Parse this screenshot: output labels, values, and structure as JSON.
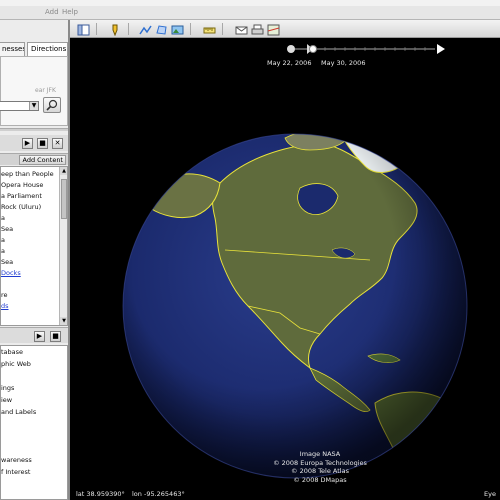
{
  "menu": {
    "items": [
      "Add",
      "Help"
    ]
  },
  "toolbar": {
    "buttons": [
      "sidebar-toggle-icon",
      "placemark-icon",
      "path-icon",
      "polygon-icon",
      "overlay-icon",
      "ruler-icon",
      "email-icon",
      "print-icon",
      "maps-icon"
    ]
  },
  "sidebar": {
    "tabs": [
      "nesses",
      "Directions"
    ],
    "search_hint": "ear JFK",
    "add_content": "Add Content",
    "places_controls": [
      "▶",
      "■",
      "✕"
    ],
    "places": [
      {
        "text": "eep than People",
        "link": false
      },
      {
        "text": " Opera House",
        "link": false
      },
      {
        "text": "a Parliament",
        "link": false
      },
      {
        "text": "Rock (Uluru)",
        "link": false
      },
      {
        "text": "a",
        "link": false
      },
      {
        "text": "Sea",
        "link": false
      },
      {
        "text": "a",
        "link": false
      },
      {
        "text": "a",
        "link": false
      },
      {
        "text": "Sea",
        "link": false
      },
      {
        "text": " Docks",
        "link": true
      },
      {
        "text": "",
        "link": false
      },
      {
        "text": "re",
        "link": false
      },
      {
        "text": "ds",
        "link": true
      }
    ],
    "layers_controls": [
      "▶",
      "■"
    ],
    "layers": [
      "tabase",
      "phic Web",
      "",
      "ings",
      "iew",
      "and Labels",
      "",
      "",
      "",
      "wareness",
      "f Interest"
    ]
  },
  "view": {
    "time": {
      "start": "May 22, 2006",
      "end": "May 30, 2006"
    },
    "credits": [
      "Image NASA",
      "© 2008 Europa Technologies",
      "© 2008 Tele Atlas",
      "© 2008 DMapas"
    ],
    "status": {
      "lat": "lat  38.959390°",
      "lon": "lon  -95.265463°",
      "right": "Eye"
    }
  },
  "colors": {
    "ocean": "#1b2a6d",
    "land": "#5f6b3c",
    "border": "#e8e23a",
    "ice": "#e9eef0"
  }
}
